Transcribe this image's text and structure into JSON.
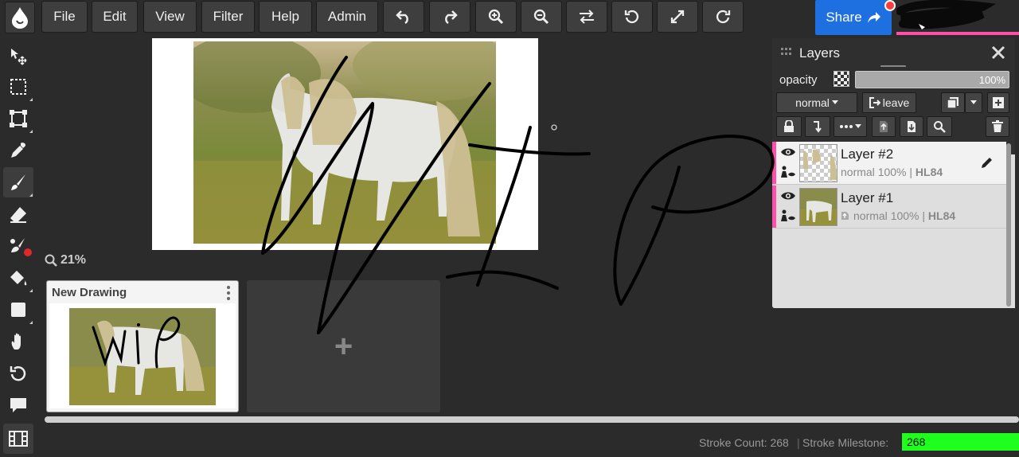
{
  "menu": {
    "file": "File",
    "edit": "Edit",
    "view": "View",
    "filter": "Filter",
    "help": "Help",
    "admin": "Admin"
  },
  "toolbar_icons": [
    "undo-icon",
    "redo-icon",
    "zoom-in-icon",
    "zoom-out-icon",
    "flip-icon",
    "rotate-left-icon",
    "fullscreen-icon",
    "rotate-right-icon"
  ],
  "share": {
    "label": "Share"
  },
  "canvas": {
    "zoom": "21%"
  },
  "documents": [
    {
      "title": "New Drawing"
    }
  ],
  "new_document_symbol": "+",
  "layers_panel": {
    "title": "Layers",
    "opacity_label": "opacity",
    "opacity_value": "100%",
    "opacity_fraction": 1.0,
    "blend_mode": "normal",
    "leave_label": "leave",
    "layers": [
      {
        "name": "Layer #2",
        "mode": "normal",
        "opacity": "100%",
        "owner": "HL84"
      },
      {
        "name": "Layer #1",
        "mode": "normal",
        "opacity": "100%",
        "owner": "HL84"
      }
    ]
  },
  "status": {
    "stroke_count": "Stroke Count: 268",
    "milestone_label": "Stroke Milestone:",
    "milestone_value": "268"
  },
  "colors": {
    "accent": "#1e6fe0",
    "user_bar": "#ff4fa8",
    "milestone": "#1eff1e"
  }
}
